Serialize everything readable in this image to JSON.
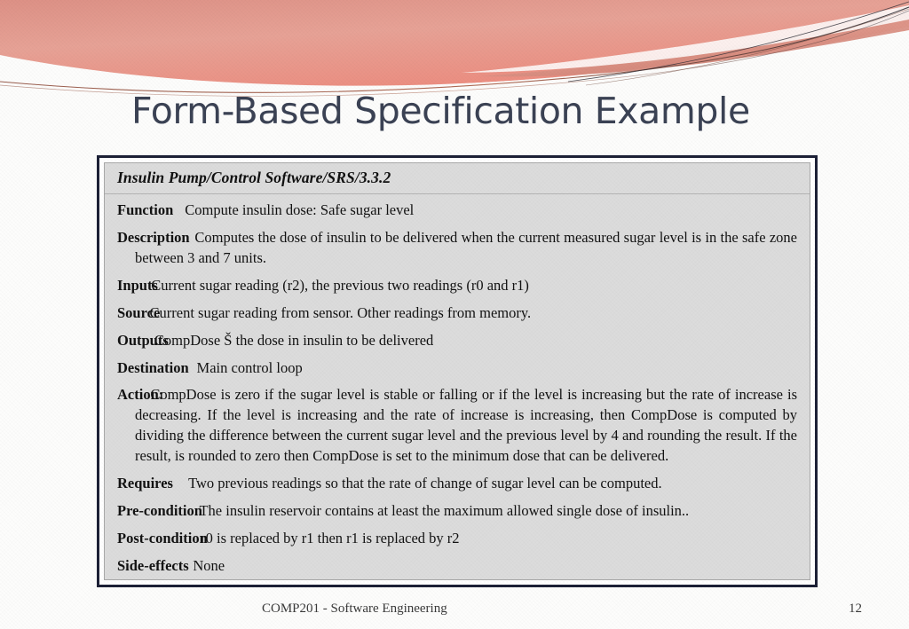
{
  "slide": {
    "title": "Form-Based Specification Example",
    "title_color": "#3b4254",
    "ribbon_color_top": "#d98b80",
    "ribbon_color_bottom": "#e8988c",
    "panel_color": "#dcdcdc",
    "frame_color": "#1c2036"
  },
  "form": {
    "header": "Insulin Pump/Control Software/SRS/3.3.2",
    "rows": [
      {
        "label": "Function",
        "gap": "        ",
        "value": "Compute insulin dose: Safe sugar level"
      },
      {
        "label": "Description",
        "gap": "      ",
        "value": "Computes the dose of insulin to be delivered when the current measured sugar level is in the safe zone between 3 and 7 units."
      },
      {
        "label": "Inputs",
        "gap": "   ",
        "value": "Current sugar reading (r2), the previous two readings (r0 and r1)"
      },
      {
        "label": "Source",
        "gap": "  ",
        "value": "Current sugar reading from sensor. Other readings from memory."
      },
      {
        "label": "Outputs",
        "gap": " ",
        "value": "CompDose Š the dose in insulin to be delivered"
      },
      {
        "label": "Destination",
        "gap": "       ",
        "value": "Main control loop"
      },
      {
        "label": "Action:",
        "gap": " ",
        "value": "CompDose is zero if the sugar level is stable or falling or if the level is increasing but the rate of increase is decreasing. If the level is increasing and the rate of increase is increasing, then CompDose is computed by dividing the difference between the current sugar level and the previous level by 4 and rounding the result. If the result, is rounded to zero then CompDose is set to the minimum dose that can be delivered."
      },
      {
        "label": "Requires",
        "gap": "         ",
        "value": "Two previous readings so that the rate of change of sugar level can be computed."
      },
      {
        "label": "Pre-condition",
        "gap": "    ",
        "value": "The insulin reservoir contains at least the maximum allowed single dose of insulin.."
      },
      {
        "label": "Post-condition",
        "gap": "   ",
        "value": "r0 is replaced by r1 then r1 is replaced by r2"
      },
      {
        "label": "Side-effects",
        "gap": "      ",
        "value": "None"
      }
    ]
  },
  "footer": {
    "course": "COMP201 - Software Engineering",
    "page_number": "12"
  }
}
